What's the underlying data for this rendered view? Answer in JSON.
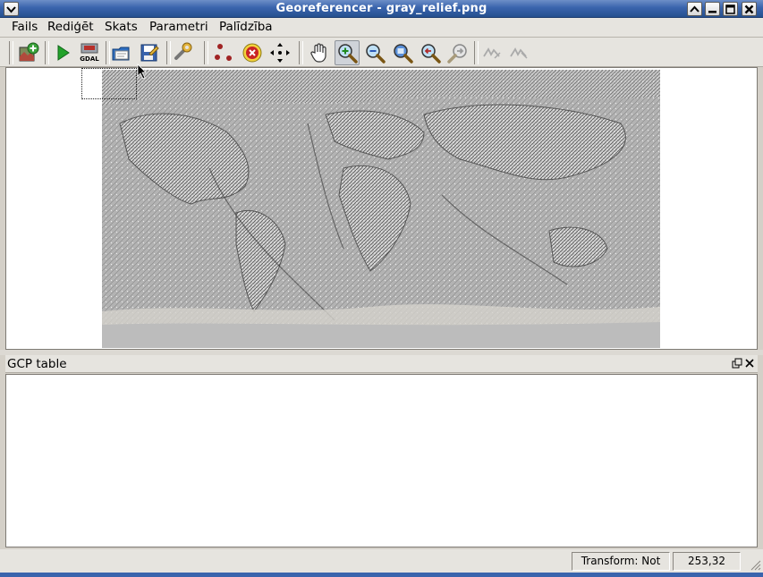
{
  "window": {
    "title": "Georeferencer - gray_relief.png"
  },
  "menubar": {
    "items": [
      {
        "label": "Fails"
      },
      {
        "label": "Rediģēt"
      },
      {
        "label": "Skats"
      },
      {
        "label": "Parametri"
      },
      {
        "label": "Palīdzība"
      }
    ]
  },
  "toolbar": {
    "tools": [
      {
        "icon": "add-raster-icon"
      },
      {
        "icon": "start-georeferencing-icon"
      },
      {
        "icon": "generate-gdal-script-icon",
        "text": "GDAL"
      },
      {
        "icon": "load-gcp-points-icon"
      },
      {
        "icon": "save-gcp-points-icon"
      },
      {
        "icon": "transformation-settings-icon"
      },
      {
        "icon": "add-point-icon"
      },
      {
        "icon": "delete-point-icon"
      },
      {
        "icon": "move-gcp-point-icon"
      },
      {
        "icon": "pan-icon"
      },
      {
        "icon": "zoom-in-icon",
        "active": true
      },
      {
        "icon": "zoom-out-icon"
      },
      {
        "icon": "zoom-to-layer-icon"
      },
      {
        "icon": "zoom-last-icon"
      },
      {
        "icon": "zoom-next-icon"
      },
      {
        "icon": "link-georeferencer-icon",
        "disabled": true
      },
      {
        "icon": "link-qgis-icon",
        "disabled": true
      }
    ]
  },
  "gcp_table": {
    "title": "GCP table"
  },
  "statusbar": {
    "transform": "Transform: Not set",
    "coordinates": "253,32"
  },
  "colors": {
    "titlebar": "#3a64ad",
    "map_gray": "#b5b5b5"
  }
}
